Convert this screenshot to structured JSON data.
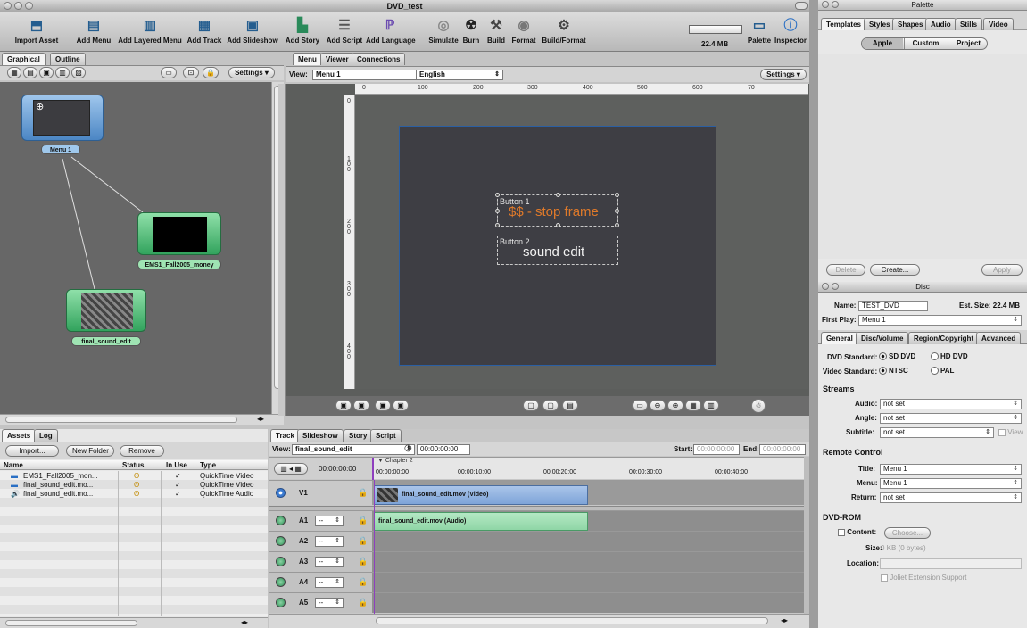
{
  "window": {
    "title": "DVD_test"
  },
  "toolbar": {
    "items": [
      {
        "label": "Import Asset",
        "icon": "import-asset-icon"
      },
      {
        "label": "Add Menu",
        "icon": "add-menu-icon"
      },
      {
        "label": "Add Layered Menu",
        "icon": "add-layered-menu-icon"
      },
      {
        "label": "Add Track",
        "icon": "add-track-icon"
      },
      {
        "label": "Add Slideshow",
        "icon": "add-slideshow-icon"
      },
      {
        "label": "Add Story",
        "icon": "add-story-icon"
      },
      {
        "label": "Add Script",
        "icon": "add-script-icon"
      },
      {
        "label": "Add Language",
        "icon": "add-language-icon"
      },
      {
        "label": "Simulate",
        "icon": "simulate-icon"
      },
      {
        "label": "Burn",
        "icon": "burn-icon"
      },
      {
        "label": "Build",
        "icon": "build-icon"
      },
      {
        "label": "Format",
        "icon": "format-icon"
      },
      {
        "label": "Build/Format",
        "icon": "build-format-icon"
      }
    ],
    "size_label": "22.4 MB",
    "palette_label": "Palette",
    "inspector_label": "Inspector"
  },
  "left_tabs": [
    "Graphical",
    "Outline"
  ],
  "left_settings": "Settings",
  "graph_nodes": {
    "menu": "Menu 1",
    "clip1": "EMS1_Fall2005_money",
    "clip2": "final_sound_edit"
  },
  "center_tabs": [
    "Menu",
    "Viewer",
    "Connections"
  ],
  "center_view": {
    "label": "View:",
    "menu": "Menu 1",
    "language": "English",
    "settings": "Settings"
  },
  "ruler_h": [
    "0",
    "100",
    "200",
    "300",
    "400",
    "500",
    "600",
    "70"
  ],
  "ruler_v": [
    "0",
    "1 0 0",
    "2 0 0",
    "3 0 0",
    "4 0 0"
  ],
  "menu_editor": {
    "button1_name": "Button 1",
    "button1_text": "$$ - stop frame",
    "button2_name": "Button 2",
    "button2_text": "sound edit",
    "text_color": "#e07a2a"
  },
  "assets": {
    "tabs": [
      "Assets",
      "Log"
    ],
    "buttons": [
      "Import...",
      "New Folder",
      "Remove"
    ],
    "columns": [
      "Name",
      "Status",
      "In Use",
      "Type"
    ],
    "rows": [
      {
        "name": "EMS1_Fall2005_mon...",
        "status": "Θ",
        "inuse": "✓",
        "type": "QuickTime Video"
      },
      {
        "name": "final_sound_edit.mo...",
        "status": "Θ",
        "inuse": "✓",
        "type": "QuickTime Video"
      },
      {
        "name": "final_sound_edit.mo...",
        "status": "Θ",
        "inuse": "✓",
        "type": "QuickTime Audio"
      }
    ]
  },
  "track": {
    "tabs": [
      "Track",
      "Slideshow",
      "Story",
      "Script"
    ],
    "view_label": "View:",
    "view_value": "final_sound_edit",
    "timecode": "00:00:00:00",
    "start_label": "Start:",
    "start_value": "00:00:00:00",
    "end_label": "End:",
    "end_value": "00:00:00:00",
    "current_time": "00:00:00:00",
    "chapter": "Chapter 2",
    "time_marks": [
      "00:00:00:00",
      "00:00:10:00",
      "00:00:20:00",
      "00:00:30:00",
      "00:00:40:00"
    ],
    "video_track": "V1",
    "video_clip": "final_sound_edit.mov (Video)",
    "audio_clip": "final_sound_edit.mov (Audio)",
    "audio_tracks": [
      "A1",
      "A2",
      "A3",
      "A4",
      "A5"
    ],
    "audio_select": "--"
  },
  "palette": {
    "title": "Palette",
    "tabs": [
      "Templates",
      "Styles",
      "Shapes",
      "Audio",
      "Stills",
      "Video"
    ],
    "segments": [
      "Apple",
      "Custom",
      "Project"
    ],
    "delete_label": "Delete",
    "create_label": "Create...",
    "apply_label": "Apply"
  },
  "disc": {
    "title": "Disc",
    "name_label": "Name:",
    "name_value": "TEST_DVD",
    "est_size": "Est. Size: 22.4 MB",
    "first_play_label": "First Play:",
    "first_play_value": "Menu 1",
    "tabs": [
      "General",
      "Disc/Volume",
      "Region/Copyright",
      "Advanced"
    ],
    "dvd_standard_label": "DVD Standard:",
    "dvd_options": [
      "SD DVD",
      "HD DVD"
    ],
    "video_standard_label": "Video Standard:",
    "video_options": [
      "NTSC",
      "PAL"
    ],
    "streams_heading": "Streams",
    "audio_label": "Audio:",
    "audio_value": "not set",
    "angle_label": "Angle:",
    "angle_value": "not set",
    "subtitle_label": "Subtitle:",
    "subtitle_value": "not set",
    "view_label": "View",
    "remote_heading": "Remote Control",
    "title_label": "Title:",
    "title_value": "Menu 1",
    "menu_label": "Menu:",
    "menu_value": "Menu 1",
    "return_label": "Return:",
    "return_value": "not set",
    "dvdrom_heading": "DVD-ROM",
    "content_label": "Content:",
    "choose_label": "Choose...",
    "size_label": "Size:",
    "size_value": "0 KB (0 bytes)",
    "location_label": "Location:",
    "joliet_label": "Joliet Extension Support"
  }
}
